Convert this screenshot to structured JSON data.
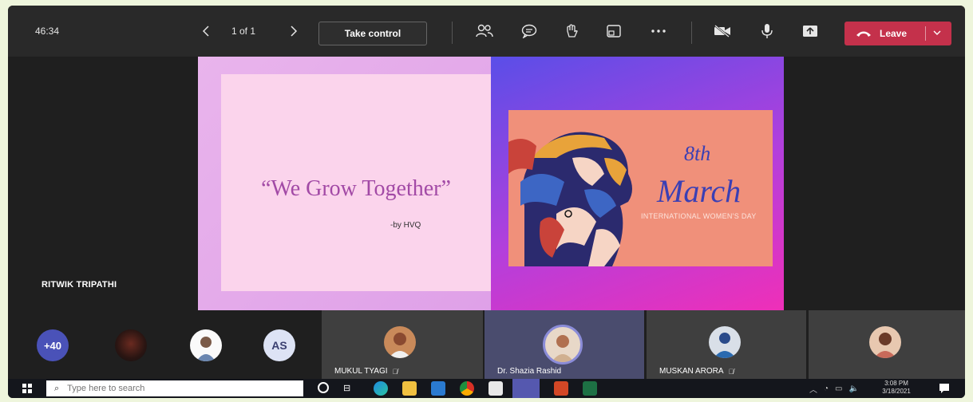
{
  "meeting": {
    "timer": "46:34",
    "page_count": "1 of 1",
    "take_control_label": "Take control",
    "leave_label": "Leave",
    "accent": "#c4314b"
  },
  "slide": {
    "quote": "“We Grow Together”",
    "byline": "-by HVQ",
    "poster_date_ordinal": "8th",
    "poster_month": "March",
    "poster_subtitle": "INTERNATIONAL WOMEN'S DAY"
  },
  "stage": {
    "presenter_name": "RITWIK TRIPATHI"
  },
  "participants": {
    "overflow_count": "+40",
    "initials_avatar": "AS",
    "tiles": [
      {
        "name": "MUKUL TYAGI",
        "muted": true
      },
      {
        "name": "Dr. Shazia Rashid",
        "muted": false
      },
      {
        "name": "MUSKAN ARORA",
        "muted": true
      },
      {
        "name": "",
        "muted": false
      }
    ]
  },
  "taskbar": {
    "search_placeholder": "Type here to search",
    "time": "3:08 PM",
    "date": "3/18/2021"
  },
  "icons": [
    "chevron-left-icon",
    "chevron-right-icon",
    "participants-icon",
    "chat-icon",
    "reactions-icon",
    "rooms-icon",
    "more-icon",
    "camera-off-icon",
    "mic-icon",
    "share-icon",
    "phone-icon",
    "chevron-down-icon"
  ]
}
